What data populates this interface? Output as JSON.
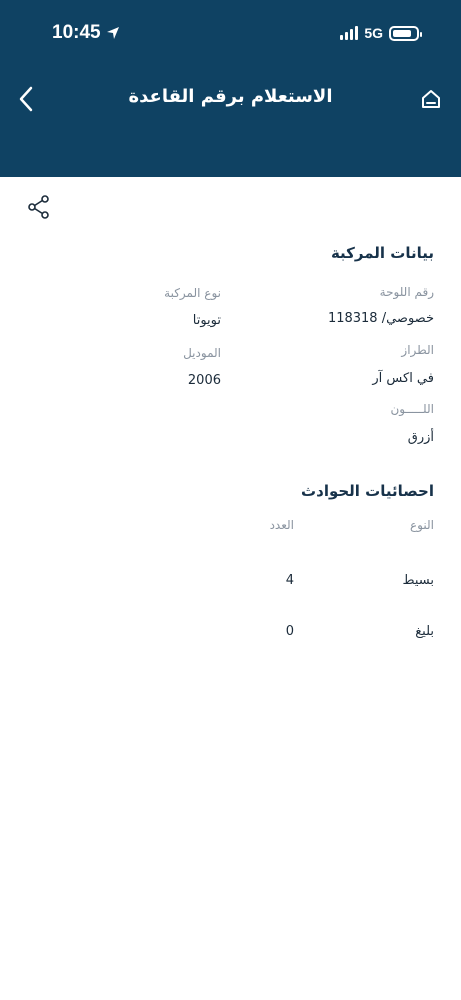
{
  "status_bar": {
    "time": "10:45",
    "network": "5G",
    "battery_fraction": 0.8
  },
  "header": {
    "title": "الاستعلام برقم القاعدة",
    "back_icon": "chevron-left-icon",
    "home_icon": "home-icon",
    "background": "#0f4263"
  },
  "share_icon": "share-icon",
  "vehicle": {
    "section_title": "بيانات المركبة",
    "fields": {
      "plate_label": "رقم اللوحة",
      "plate_value": "خصوصي/ 118318",
      "type_label": "نوع المركبة",
      "type_value": "تويوتا",
      "model_label": "الطراز",
      "model_value": "في اكس آر",
      "year_label": "الموديل",
      "year_value": "2006",
      "color_label": "اللـــــون",
      "color_value": "أزرق"
    }
  },
  "accidents": {
    "section_title": "احصائيات الحوادث",
    "header_type": "النوع",
    "header_count": "العدد",
    "rows": [
      {
        "type": "بسيط",
        "count": "4"
      },
      {
        "type": "بليغ",
        "count": "0"
      }
    ]
  }
}
